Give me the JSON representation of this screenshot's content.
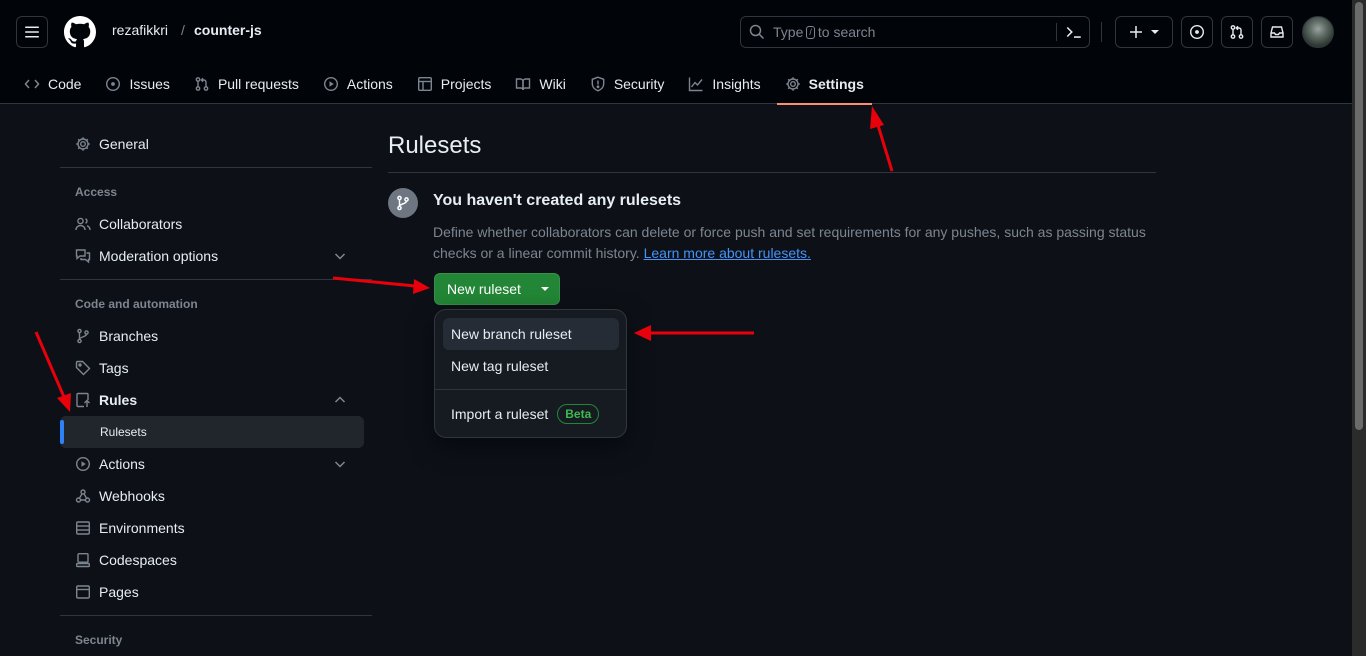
{
  "header": {
    "owner": "rezafikkri",
    "separator": "/",
    "repo": "counter-js",
    "search_prefix": "Type",
    "search_key": "/",
    "search_suffix": "to search"
  },
  "tabs": [
    {
      "label": "Code",
      "icon": "code-icon"
    },
    {
      "label": "Issues",
      "icon": "issue-opened-icon"
    },
    {
      "label": "Pull requests",
      "icon": "git-pull-request-icon"
    },
    {
      "label": "Actions",
      "icon": "play-icon"
    },
    {
      "label": "Projects",
      "icon": "table-icon"
    },
    {
      "label": "Wiki",
      "icon": "book-icon"
    },
    {
      "label": "Security",
      "icon": "shield-icon"
    },
    {
      "label": "Insights",
      "icon": "graph-icon"
    },
    {
      "label": "Settings",
      "icon": "gear-icon"
    }
  ],
  "sidebar": {
    "general": "General",
    "access_heading": "Access",
    "collaborators": "Collaborators",
    "moderation": "Moderation options",
    "code_heading": "Code and automation",
    "branches": "Branches",
    "tags": "Tags",
    "rules": "Rules",
    "rulesets": "Rulesets",
    "actions": "Actions",
    "webhooks": "Webhooks",
    "environments": "Environments",
    "codespaces": "Codespaces",
    "pages": "Pages",
    "security_heading": "Security"
  },
  "main": {
    "title": "Rulesets",
    "blank_heading": "You haven't created any rulesets",
    "blank_text": "Define whether collaborators can delete or force push and set requirements for any pushes, such as passing status checks or a linear commit history.",
    "learn_link": "Learn more about rulesets.",
    "new_button": "New ruleset"
  },
  "menu": {
    "branch": "New branch ruleset",
    "tag": "New tag ruleset",
    "import": "Import a ruleset",
    "beta": "Beta"
  },
  "colors": {
    "background": "#0d1117",
    "header": "#010409",
    "accent_green": "#238636",
    "active_tab_underline": "#fd8c73",
    "link": "#4493f8",
    "annotation_arrow": "#e8000b"
  }
}
